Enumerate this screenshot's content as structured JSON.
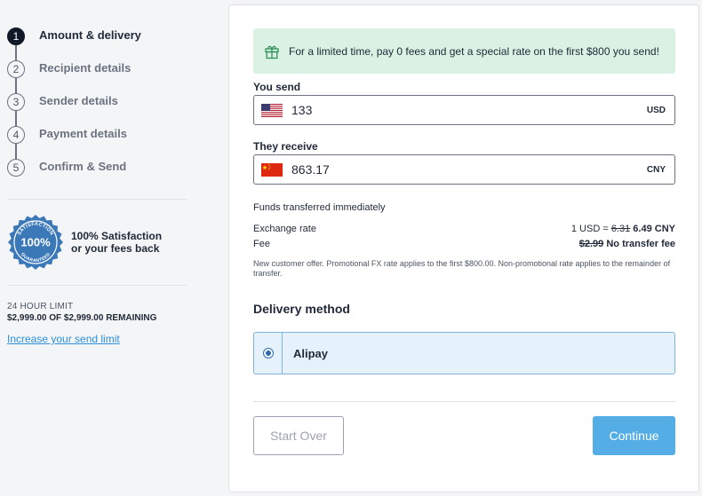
{
  "steps": [
    {
      "number": "1",
      "label": "Amount & delivery",
      "active": true
    },
    {
      "number": "2",
      "label": "Recipient details",
      "active": false
    },
    {
      "number": "3",
      "label": "Sender details",
      "active": false
    },
    {
      "number": "4",
      "label": "Payment details",
      "active": false
    },
    {
      "number": "5",
      "label": "Confirm & Send",
      "active": false
    }
  ],
  "guarantee": {
    "seal_top": "SATISFACTION",
    "seal_value": "100%",
    "seal_bottom": "GUARANTEED",
    "line1": "100% Satisfaction",
    "line2": "or your fees back"
  },
  "limit": {
    "title": "24 HOUR LIMIT",
    "remaining": "$2,999.00 OF $2,999.00 REMAINING",
    "link": "Increase your send limit"
  },
  "promo": {
    "icon": "gift-icon",
    "text": "For a limited time, pay 0 fees and get a special rate on the first $800 you send!"
  },
  "send": {
    "label": "You send",
    "flag": "us-flag-icon",
    "value": "133",
    "currency": "USD"
  },
  "receive": {
    "label": "They receive",
    "flag": "cn-flag-icon",
    "value": "863.17",
    "currency": "CNY"
  },
  "funds_note": "Funds transferred immediately",
  "exchange": {
    "label": "Exchange rate",
    "prefix": "1 USD =",
    "old_rate": "6.31",
    "new_rate": "6.49 CNY"
  },
  "fee": {
    "label": "Fee",
    "old_fee": "$2.99",
    "new_fee": "No transfer fee"
  },
  "fine_print": "New customer offer. Promotional FX rate applies to the first $800.00. Non-promotional rate applies to the remainder of transfer.",
  "delivery": {
    "title": "Delivery method",
    "option": "Alipay",
    "selected": true
  },
  "buttons": {
    "start_over": "Start Over",
    "continue": "Continue"
  },
  "colors": {
    "accent": "#54aee5",
    "promo_bg": "#d9f2e3",
    "link": "#2b8fd8",
    "seal": "#3a78b8"
  }
}
